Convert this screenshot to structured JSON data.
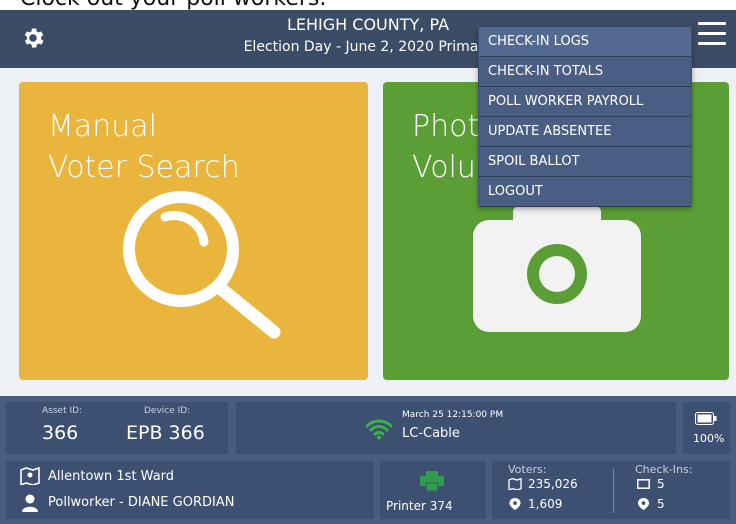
{
  "caption": "Clock out your poll workers.",
  "header": {
    "title": "LEHIGH COUNTY, PA",
    "subtitle": "Election Day - June 2, 2020 Primary"
  },
  "tiles": {
    "search": {
      "line1": "Manual",
      "line2": "Voter Search"
    },
    "photo": {
      "line1": "Phot",
      "line2": "Volu"
    }
  },
  "menu": {
    "items": [
      "CHECK-IN LOGS",
      "CHECK-IN TOTALS",
      "POLL WORKER PAYROLL",
      "UPDATE ABSENTEE",
      "SPOIL BALLOT",
      "LOGOUT"
    ]
  },
  "footer": {
    "asset_label": "Asset ID:",
    "asset_value": "366",
    "device_label": "Device ID:",
    "device_value": "EPB 366",
    "datetime": "March 25  12:15:00 PM",
    "network": "LC-Cable",
    "battery": "100%",
    "ward": "Allentown 1st Ward",
    "pollworker": "Pollworker - DIANE GORDIAN",
    "printer": "Printer 374",
    "voters_label": "Voters:",
    "voters_total": "235,026",
    "voters_checked": "1,609",
    "checkins_label": "Check-Ins:",
    "checkins_a": "5",
    "checkins_b": "5"
  },
  "colors": {
    "header": "#3b4c67",
    "search_tile": "#e9b53d",
    "photo_tile": "#5b9e35",
    "wifi": "#3ab04a",
    "printer": "#2e9e4a"
  },
  "icons": [
    "gear-icon",
    "hamburger-menu-icon",
    "magnifier-icon",
    "camera-icon",
    "wifi-icon",
    "battery-icon",
    "map-pin-icon",
    "person-icon",
    "printer-icon",
    "ballot-icon",
    "location-icon"
  ]
}
